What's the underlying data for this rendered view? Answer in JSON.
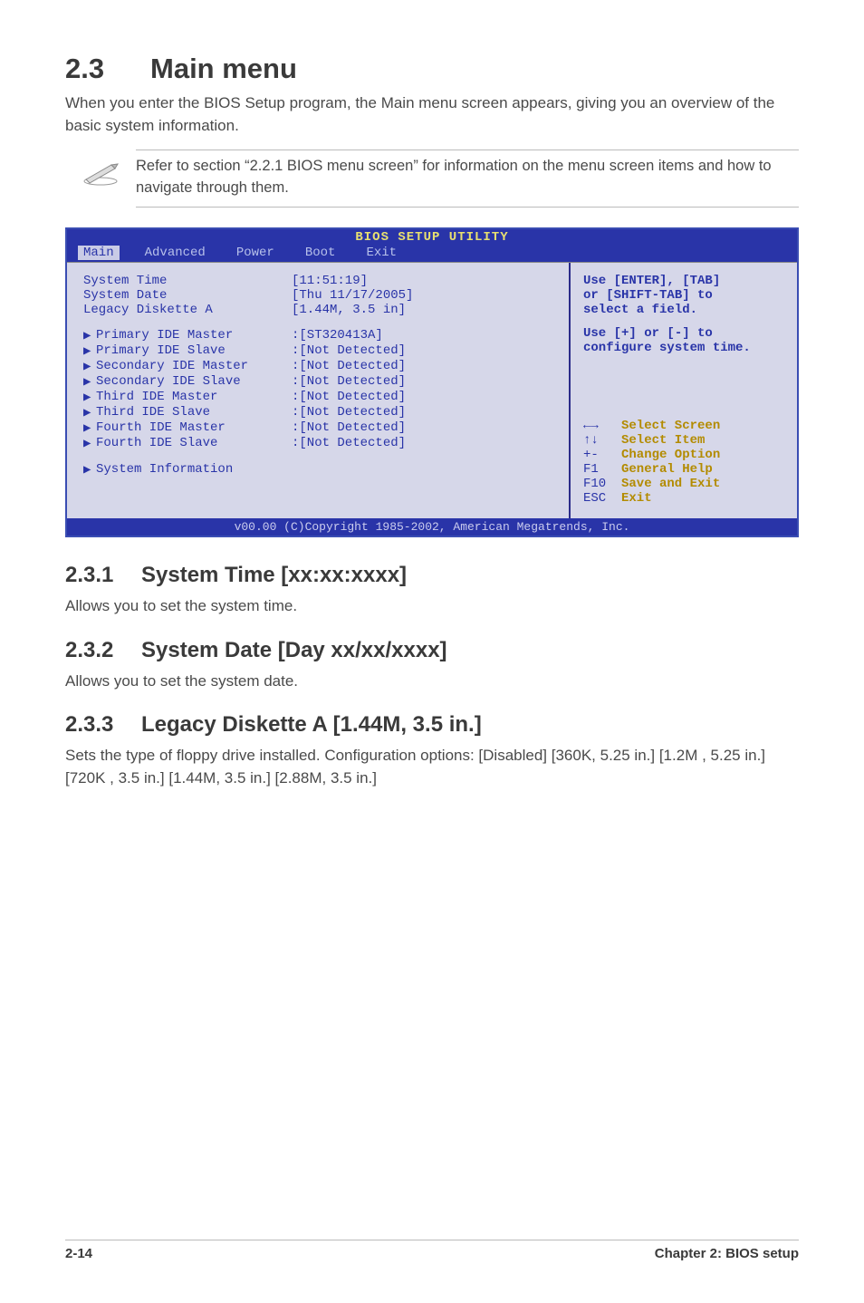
{
  "heading": {
    "number": "2.3",
    "title": "Main menu"
  },
  "intro": "When you enter the BIOS Setup program, the Main menu screen appears, giving you an overview of the basic system information.",
  "note": "Refer to section “2.2.1  BIOS menu screen” for information on the menu screen items and how to navigate through them.",
  "bios": {
    "title": "BIOS SETUP UTILITY",
    "tabs": [
      "Main",
      "Advanced",
      "Power",
      "Boot",
      "Exit"
    ],
    "active_tab": 0,
    "rows_top": [
      {
        "k": "System Time",
        "v": "[11:51:19]"
      },
      {
        "k": "System Date",
        "v": "[Thu 11/17/2005]"
      },
      {
        "k": "Legacy Diskette A",
        "v": "[1.44M, 3.5 in]"
      }
    ],
    "rows_mid": [
      {
        "k": "Primary IDE Master",
        "v": ":[ST320413A]"
      },
      {
        "k": "Primary IDE Slave",
        "v": ":[Not Detected]"
      },
      {
        "k": "Secondary IDE Master",
        "v": ":[Not Detected]"
      },
      {
        "k": "Secondary IDE Slave",
        "v": ":[Not Detected]"
      },
      {
        "k": "Third IDE Master",
        "v": ":[Not Detected]"
      },
      {
        "k": "Third IDE Slave",
        "v": ":[Not Detected]"
      },
      {
        "k": "Fourth IDE Master",
        "v": ":[Not Detected]"
      },
      {
        "k": "Fourth IDE Slave",
        "v": ":[Not Detected]"
      }
    ],
    "rows_bot": [
      {
        "k": "System Information",
        "v": ""
      }
    ],
    "help_upper": [
      "Use [ENTER], [TAB]",
      "or [SHIFT-TAB] to",
      "select a field.",
      "",
      "Use [+] or [-] to",
      "configure system time."
    ],
    "help_keys": [
      {
        "sym": "←→",
        "lbl": "Select Screen"
      },
      {
        "sym": "↑↓",
        "lbl": "Select Item"
      },
      {
        "sym": "+-",
        "lbl": "Change Option"
      },
      {
        "sym": "F1",
        "lbl": "General Help"
      },
      {
        "sym": "F10",
        "lbl": "Save and Exit"
      },
      {
        "sym": "ESC",
        "lbl": "Exit"
      }
    ],
    "footer": "v00.00 (C)Copyright 1985-2002, American Megatrends, Inc."
  },
  "subs": [
    {
      "num": "2.3.1",
      "title": "System Time [xx:xx:xxxx]",
      "body": "Allows you to set the system time."
    },
    {
      "num": "2.3.2",
      "title": "System Date [Day xx/xx/xxxx]",
      "body": "Allows you to set the system date."
    },
    {
      "num": "2.3.3",
      "title": "Legacy Diskette A [1.44M, 3.5 in.]",
      "body": "Sets the type of floppy drive installed. Configuration options: [Disabled] [360K, 5.25 in.] [1.2M , 5.25 in.] [720K , 3.5 in.] [1.44M, 3.5 in.] [2.88M, 3.5 in.]"
    }
  ],
  "footer": {
    "left": "2-14",
    "right": "Chapter 2: BIOS setup"
  }
}
